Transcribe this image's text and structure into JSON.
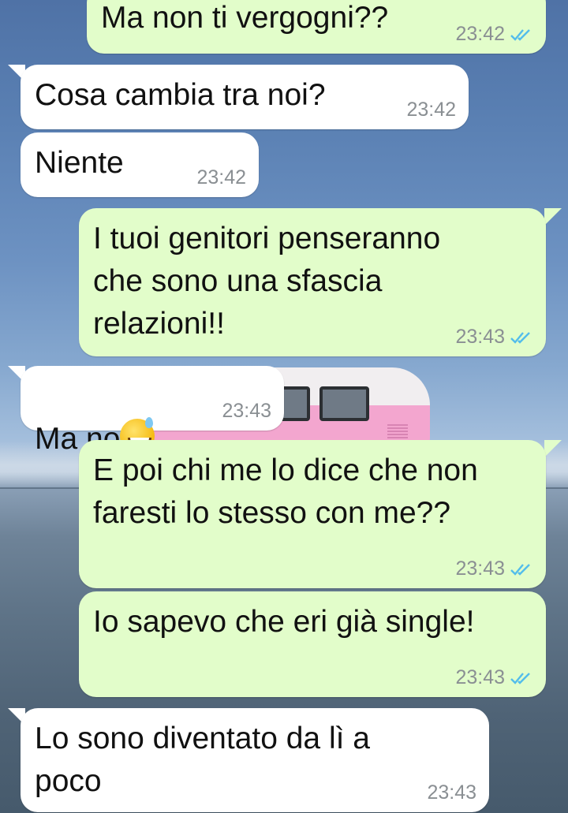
{
  "chat": {
    "messages": [
      {
        "direction": "out",
        "text": "Ma non ti vergogni??",
        "time": "23:42",
        "status": "read"
      },
      {
        "direction": "in",
        "text": "Cosa cambia tra noi?",
        "time": "23:42"
      },
      {
        "direction": "in",
        "text": "Niente",
        "time": "23:42"
      },
      {
        "direction": "out",
        "text": "I tuoi genitori penseranno\nche sono una sfascia\nrelazioni!!",
        "time": "23:43",
        "status": "read"
      },
      {
        "direction": "in",
        "text": "Ma no",
        "emoji": "grinning-face-with-sweat",
        "time": "23:43"
      },
      {
        "direction": "out",
        "text": "E poi chi me lo dice che non\nfaresti lo stesso con me??",
        "time": "23:43",
        "status": "read"
      },
      {
        "direction": "out",
        "text": "Io sapevo che eri già single!",
        "time": "23:43",
        "status": "read"
      },
      {
        "direction": "in",
        "text": "Lo sono diventato da lì a\npoco",
        "time": "23:43"
      }
    ]
  },
  "colors": {
    "outgoing_bubble": "#e2fdca",
    "incoming_bubble": "#ffffff",
    "read_ticks": "#53bdeb",
    "timestamp": "#8a8f93"
  },
  "icons": {
    "read_receipt": "double-check-icon",
    "emoji": "grinning-face-with-sweat"
  }
}
